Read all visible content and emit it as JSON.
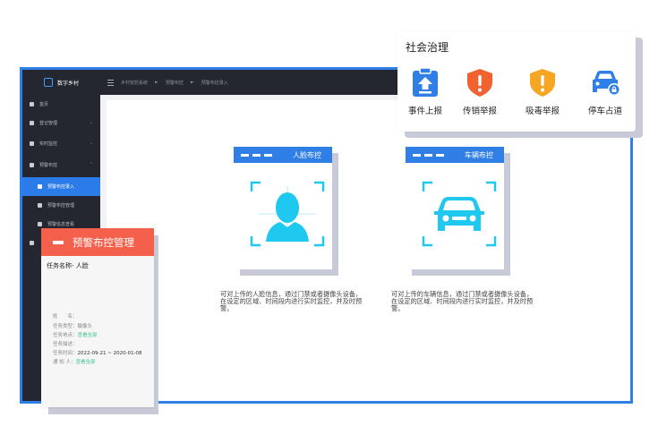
{
  "sidebar": {
    "app_name": "数字乡村",
    "items": [
      {
        "label": "首页"
      },
      {
        "label": "登记管理"
      },
      {
        "label": "实时监控"
      },
      {
        "label": "预警布控"
      },
      {
        "label": "预警布控录入"
      },
      {
        "label": "预警布控管理"
      },
      {
        "label": "预警信息查看"
      }
    ]
  },
  "topbar": {
    "breadcrumb": [
      "乡村安防系统",
      "预警布控",
      "预警布控录入"
    ],
    "separator": "►"
  },
  "features": [
    {
      "title": "人脸布控",
      "icon": "face-icon",
      "description": "可对上传的人脸信息，通过门禁或者摄像头设备，在设定的区域、时间段内进行实时监控，并及时预警。"
    },
    {
      "title": "车辆布控",
      "icon": "car-icon",
      "description": "可对上传的车辆信息，通过门禁或者摄像头设备，在设定的区域、时间段内进行实时监控，并及时预警。"
    }
  ],
  "governance": {
    "title": "社会治理",
    "items": [
      {
        "label": "事件上报",
        "icon": "clipboard-upload-icon",
        "color": "#2f7fe6"
      },
      {
        "label": "传销举报",
        "icon": "shield-alert-icon",
        "color": "#f0622f"
      },
      {
        "label": "吸毒举报",
        "icon": "shield-warning-icon",
        "color": "#f5a623"
      },
      {
        "label": "停车占道",
        "icon": "car-lock-icon",
        "color": "#2f7fe6"
      }
    ]
  },
  "alert_card": {
    "title": "预警布控管理",
    "task_name": "任务名称- 人脸",
    "lines": [
      {
        "label": "姓　　名：",
        "value": ""
      },
      {
        "label": "任务类型：",
        "value": "摄像头"
      },
      {
        "label": "任务地点：",
        "value": "查看全部"
      },
      {
        "label": "任务描述：",
        "value": ""
      },
      {
        "label": "任务时间：",
        "value": "2022-09-21 ~ 2020-01-08"
      },
      {
        "label": "通 知 人：",
        "value": "查看全部"
      }
    ]
  },
  "colors": {
    "accent": "#2f7fe6",
    "alert_red": "#f4604b",
    "sidebar_bg": "#24272f",
    "face_cyan": "#1ec8ee"
  }
}
